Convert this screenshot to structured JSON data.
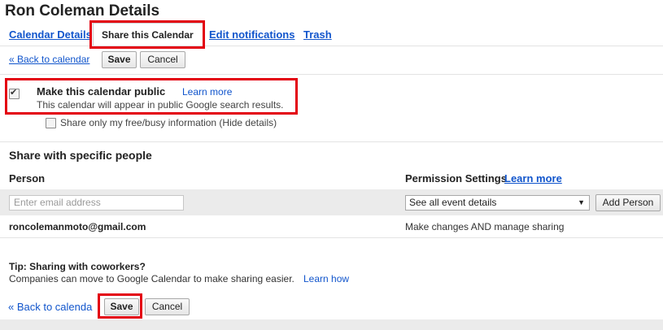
{
  "page": {
    "title": "Ron Coleman Details"
  },
  "tabs": [
    {
      "label": "Calendar Details",
      "active": false
    },
    {
      "label": "Share this Calendar",
      "active": true
    },
    {
      "label": "Edit notifications",
      "active": false
    },
    {
      "label": "Trash",
      "active": false
    }
  ],
  "top_actions": {
    "back_label": "« Back to calendar",
    "save_label": "Save",
    "cancel_label": "Cancel"
  },
  "public": {
    "label": "Make this calendar public",
    "checked": true,
    "learn_more": "Learn more",
    "description": "This calendar will appear in public Google search results."
  },
  "freebusy": {
    "label": "Share only my free/busy information (Hide details)",
    "checked": false
  },
  "specific": {
    "heading": "Share with specific people",
    "person_header": "Person",
    "permission_header": "Permission Settings",
    "permission_learn_more": "Learn more",
    "email_placeholder": "Enter email address",
    "permission_selected": "See all event details",
    "add_person_label": "Add Person",
    "rows": [
      {
        "person": "roncolemanmoto@gmail.com",
        "permission": "Make changes AND manage sharing"
      }
    ]
  },
  "tip": {
    "heading": "Tip: Sharing with coworkers?",
    "text": "Companies can move to Google Calendar to make sharing easier.",
    "link": "Learn how"
  },
  "bottom_actions": {
    "back_label": "« Back to calenda",
    "save_label": "Save",
    "cancel_label": "Cancel"
  },
  "colors": {
    "link": "#1155cc",
    "highlight_box": "#e3000f",
    "row_background": "#ebebeb"
  }
}
